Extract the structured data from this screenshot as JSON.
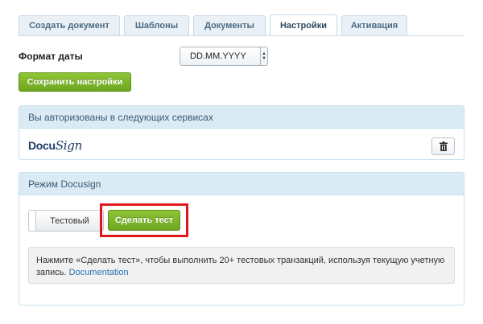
{
  "tabs": [
    {
      "label": "Создать документ"
    },
    {
      "label": "Шаблоны"
    },
    {
      "label": "Документы"
    },
    {
      "label": "Настройки"
    },
    {
      "label": "Активация"
    }
  ],
  "active_tab": "Настройки",
  "settings": {
    "date_format_label": "Формат даты",
    "date_format_value": "DD.MM.YYYY",
    "save_button": "Сохранить настройки"
  },
  "auth_panel": {
    "title": "Вы авторизованы в следующих сервисах",
    "service_logo_prefix": "Docu",
    "service_logo_suffix": "Sign"
  },
  "mode_panel": {
    "title": "Режим Docusign",
    "toggle_label": "Тестовый",
    "test_button": "Сделать тест",
    "info_text": "Нажмите «Сделать тест», чтобы выполнить 20+ тестовых транзакций, используя текущую учетную запись.",
    "info_link": "Documentation"
  },
  "colors": {
    "accent_green": "#7bb52a",
    "panel_header": "#dbebf5",
    "highlight": "#e0161a"
  },
  "icons": [
    "trash-icon",
    "select-arrows-icon"
  ]
}
